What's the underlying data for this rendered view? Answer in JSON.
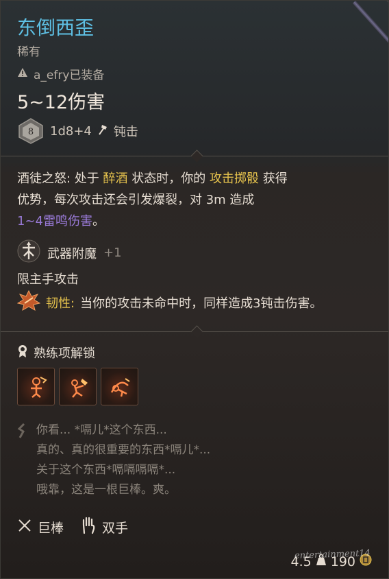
{
  "item": {
    "name": "东倒西歪",
    "rarity": "稀有",
    "equipped_by": "a_efry已装备",
    "damage_range": "5~12伤害",
    "dice_value": "8",
    "dice_formula": "1d8+4",
    "damage_type": "钝击"
  },
  "passive": {
    "prefix": "酒徒之怒: 处于 ",
    "condition": "醉酒",
    "mid1": " 状态时，你的 ",
    "action": "攻击掷骰",
    "mid2": " 获得",
    "line2": "优势，每次攻击还会引发爆裂，对 3m 造成",
    "extra_damage": "1~4雷鸣伤害",
    "end": "。"
  },
  "enchant": {
    "label": "武器附魔",
    "bonus": "+1"
  },
  "restriction": "限主手攻击",
  "toughness": {
    "label": "韧性:",
    "text": "当你的攻击未命中时，同样造成3钝击伤害。"
  },
  "proficiency": {
    "label": "熟练项解锁",
    "icons": [
      "cleave-skill-icon",
      "concussive-smash-skill-icon",
      "topple-skill-icon"
    ]
  },
  "flavor": [
    "你看... *嗝儿*这个东西...",
    "真的、真的很重要的东西*嗝儿*...",
    "关于这个东西*嗝嗝嗝嗝*...",
    "哦靠，这是一根巨棒。爽。"
  ],
  "tags": {
    "weapon_type": "巨棒",
    "handedness": "双手"
  },
  "footer": {
    "weight": "4.5",
    "price": "190",
    "watermark": "entertainment14"
  },
  "colors": {
    "title": "#5ec0e4",
    "highlight": "#e5c24d",
    "thunder": "#9a7ad8",
    "muted": "#8f8880"
  }
}
